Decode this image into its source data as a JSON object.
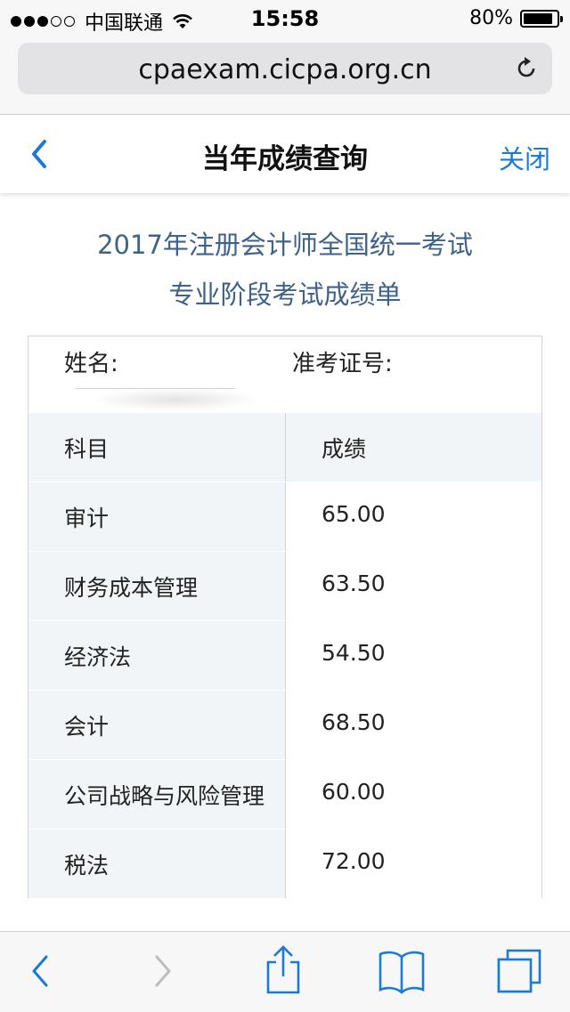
{
  "status_bar": {
    "carrier": "中国联通",
    "time": "15:58",
    "battery": "80%"
  },
  "browser": {
    "url": "cpaexam.cicpa.org.cn"
  },
  "nav": {
    "title": "当年成绩查询",
    "close_label": "关闭"
  },
  "report": {
    "title_line1": "2017年注册会计师全国统一考试",
    "title_line2": "专业阶段考试成绩单",
    "name_label": "姓名:",
    "exam_id_label": "准考证号:",
    "columns": [
      "科目",
      "成绩"
    ],
    "rows": [
      {
        "subject": "审计",
        "score": "65.00"
      },
      {
        "subject": "财务成本管理",
        "score": "63.50"
      },
      {
        "subject": "经济法",
        "score": "54.50"
      },
      {
        "subject": "会计",
        "score": "68.50"
      },
      {
        "subject": "公司战略与风险管理",
        "score": "60.00"
      },
      {
        "subject": "税法",
        "score": "72.00"
      }
    ]
  },
  "colors": {
    "accent": "#1a7ad8",
    "heading": "#3f6288",
    "cell_shade": "#f2f5f7",
    "border": "#cfd4d8"
  },
  "icons": {
    "back": "chevron-left-icon",
    "forward": "chevron-right-icon",
    "share": "share-icon",
    "bookmarks": "book-icon",
    "tabs": "tabs-icon",
    "reload": "reload-icon"
  }
}
